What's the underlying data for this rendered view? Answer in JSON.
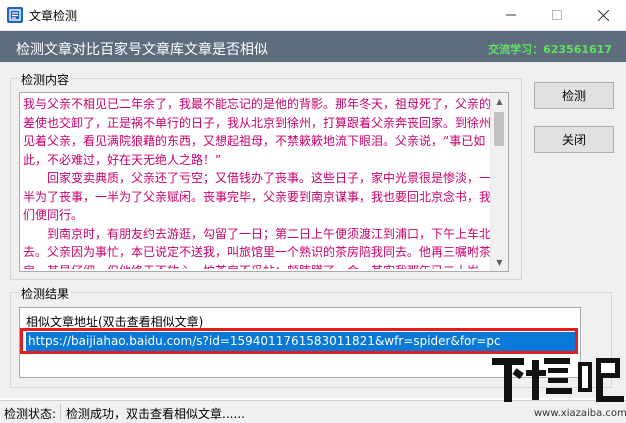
{
  "window": {
    "title": "文章检测",
    "controls": [
      "minimize-icon",
      "maximize-icon",
      "close-icon"
    ]
  },
  "banner": {
    "title": "检测文章对比百家号文章库文章是否相似",
    "contact": "交流学习：623561617",
    "bg_color": "#5d6d7e",
    "contact_color": "#5ee35e"
  },
  "content_group": {
    "label": "检测内容",
    "paragraphs": [
      "我与父亲不相见已二年余了，我最不能忘记的是他的背影。那年冬天，祖母死了，父亲的差使也交卸了，正是祸不单行的日子，我从北京到徐州，打算跟着父亲奔丧回家。到徐州见着父亲，看见满院狼藉的东西，又想起祖母，不禁簌簌地流下眼泪。父亲说，“事已如此，不必难过，好在天无绝人之路！”",
      "　　回家变卖典质，父亲还了亏空；又借钱办了丧事。这些日子，家中光景很是惨淡，一半为了丧事，一半为了父亲赋闲。丧事完毕，父亲要到南京谋事，我也要回北京念书，我们便同行。",
      "　　到南京时，有朋友约去游逛，勾留了一日；第二日上午便须渡江到浦口，下午上车北去。父亲因为事忙，本已说定不送我，叫旅馆里一个熟识的茶房陪我同去。他再三嘱咐茶房，甚是仔细。但他终于不放心，怕茶房不妥帖；颇踌躇了一会。其实我那年已二十岁，北京已来往过两三次，是没有甚么要紧的了。"
    ],
    "text_color": "#c8006e"
  },
  "buttons": {
    "detect": "检测",
    "close": "关闭"
  },
  "result_group": {
    "label": "检测结果",
    "column_header": "相似文章地址(双击查看相似文章)",
    "rows": [
      "https://baijiahao.baidu.com/s?id=1594011761583011821&wfr=spider&for=pc"
    ],
    "selected_color": "#0a78d7",
    "highlight_color": "#e02020"
  },
  "status": {
    "label": "检测状态:",
    "text": "检测成功，双击查看相似文章......"
  },
  "watermark": {
    "logo": "下载吧",
    "url": "www.xiazaiba.com"
  }
}
